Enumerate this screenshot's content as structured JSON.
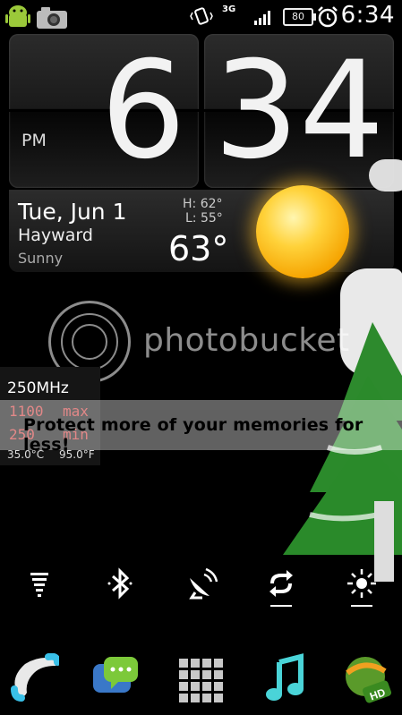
{
  "status_bar": {
    "network": "3G",
    "battery": "80",
    "time": "6:34",
    "icons": [
      "android-icon",
      "camera-icon",
      "vibrate-icon",
      "signal-icon",
      "battery-icon",
      "alarm-icon"
    ]
  },
  "clock": {
    "hour": "6",
    "minute": "34",
    "ampm": "PM"
  },
  "weather": {
    "date": "Tue, Jun 1",
    "city": "Hayward",
    "condition": "Sunny",
    "high": "H:  62°",
    "low": "L:  55°",
    "temp": "63°"
  },
  "watermark": {
    "text": "photobucket",
    "banner": "Protect more of your memories for less!"
  },
  "cpu": {
    "freq": "250MHz",
    "max_value": "1100",
    "max_label": "max",
    "min_value": "250",
    "min_label": "min",
    "temp_c": "35.0°C",
    "temp_f": "95.0°F"
  },
  "toggles": [
    "wifi-icon",
    "bluetooth-icon",
    "gps-icon",
    "sync-icon",
    "brightness-icon"
  ],
  "dock": [
    "phone-icon",
    "messaging-icon",
    "app-drawer-icon",
    "music-icon",
    "browser-icon"
  ]
}
